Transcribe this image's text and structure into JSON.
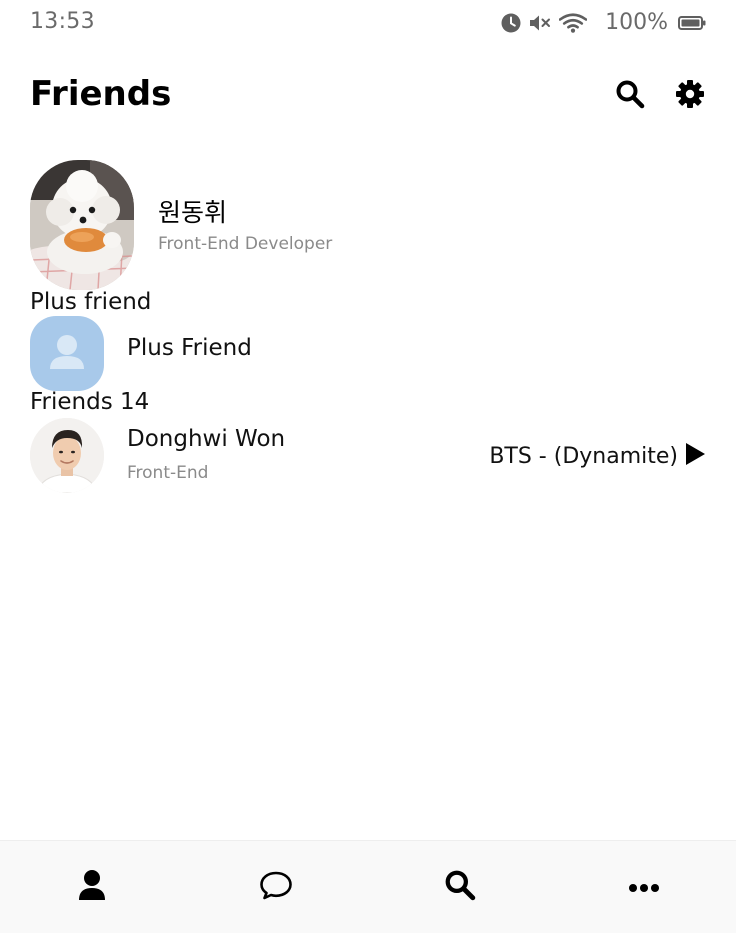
{
  "status_bar": {
    "time": "13:53",
    "battery": "100%",
    "icons": [
      "alarm-icon",
      "mute-icon",
      "wifi-icon",
      "battery-icon"
    ]
  },
  "header": {
    "title": "Friends",
    "actions": [
      "search-icon",
      "gear-icon"
    ]
  },
  "my_profile": {
    "name": "원동휘",
    "status": "Front-End Developer",
    "avatar": "puppy-photo"
  },
  "plus_section": {
    "label": "Plus friend",
    "item": {
      "name": "Plus Friend",
      "avatar": "default-person-icon"
    }
  },
  "friends_section": {
    "label": "Friends 14",
    "items": [
      {
        "name": "Donghwi Won",
        "status": "Front-End",
        "music": "BTS - (Dynamite)",
        "avatar": "portrait-photo"
      }
    ]
  },
  "bottom_nav": {
    "items": [
      "person-icon",
      "chat-icon",
      "search-icon",
      "more-icon"
    ]
  },
  "colors": {
    "plus_avatar": "#a8c9ea",
    "muted_text": "#8a8a8a",
    "status_text": "#6a6a6a",
    "nav_background": "#f9f9f9"
  }
}
